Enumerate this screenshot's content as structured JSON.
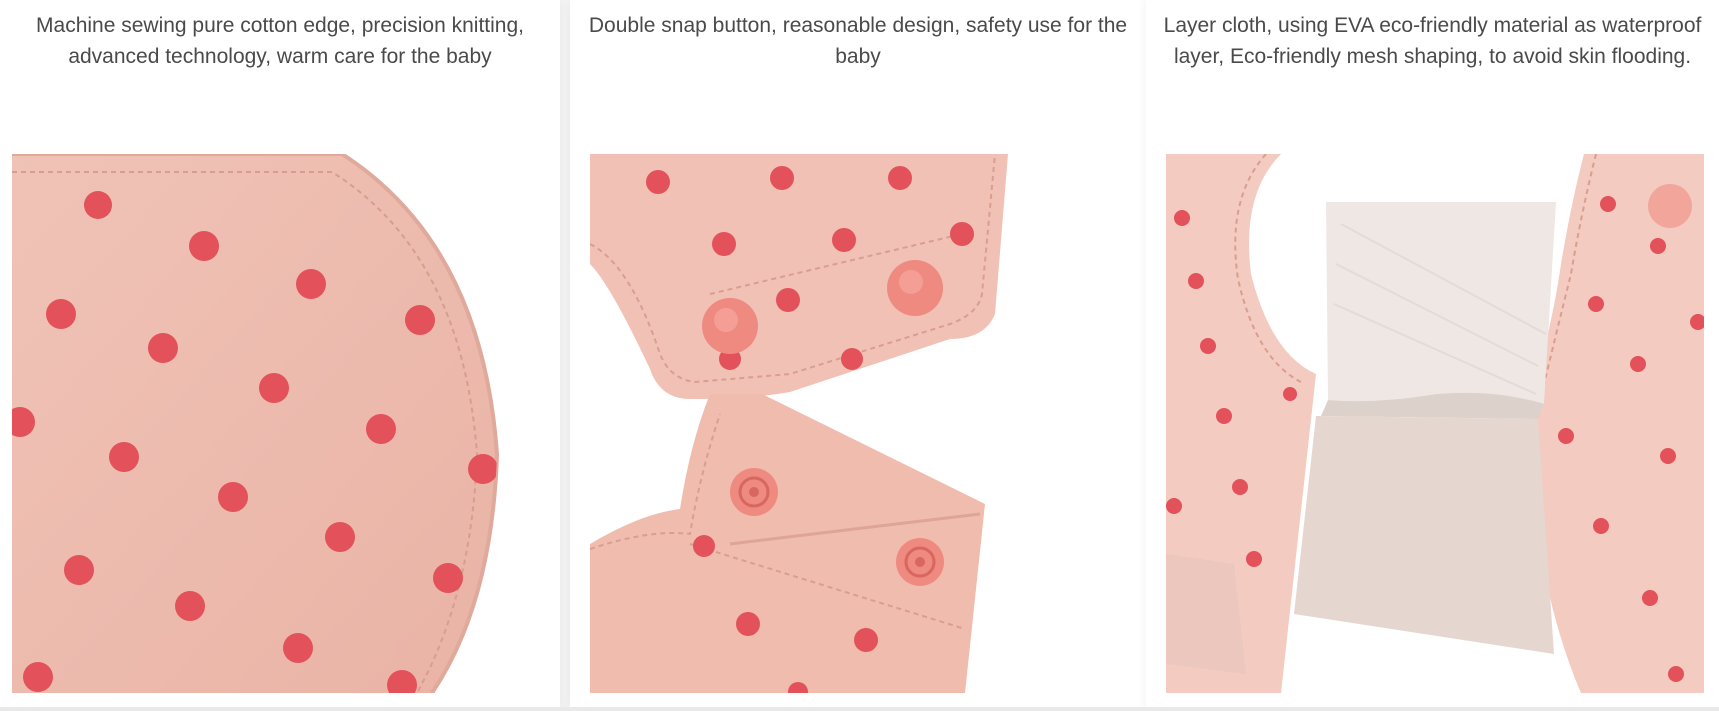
{
  "features": [
    {
      "caption": "Machine sewing pure cotton edge, precision knitting, advanced technology, warm care for the baby",
      "image_subject": "cotton-edge-closeup"
    },
    {
      "caption": "Double snap button, reasonable design, safety use for the baby",
      "image_subject": "snap-button-closeup"
    },
    {
      "caption": "Layer cloth, using EVA eco-friendly material as waterproof layer, Eco-friendly mesh shaping, to avoid skin flooding.",
      "image_subject": "waterproof-layer-closeup"
    }
  ],
  "colors": {
    "fabric": "#f2c2b6",
    "fabric_shade": "#e9b0a2",
    "dot": "#e3515a",
    "snap": "#ee8a80",
    "inner_layer": "#e6d9d3",
    "caption_text": "#4a4a4a"
  }
}
